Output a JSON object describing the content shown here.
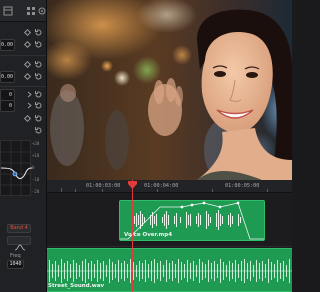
{
  "inspector": {
    "fields": [
      "0.00",
      "0.00",
      "0",
      "0"
    ],
    "eq_scale": [
      "+20",
      "+10",
      "0",
      "-10",
      "-20"
    ],
    "band_button": "Band 4",
    "freq_label": "Freq",
    "freq_value": "1040"
  },
  "timeline": {
    "timecodes": [
      "01:00:03:00",
      "01:00:04:00",
      "01:00:05:00"
    ],
    "clips": {
      "voice_over": "Voice Over.mp4",
      "street_sound": "Street_Sound.wav"
    }
  },
  "colors": {
    "playhead": "#e23b3b",
    "audio_clip": "#1f9a52",
    "band_accent": "#d9503b"
  }
}
